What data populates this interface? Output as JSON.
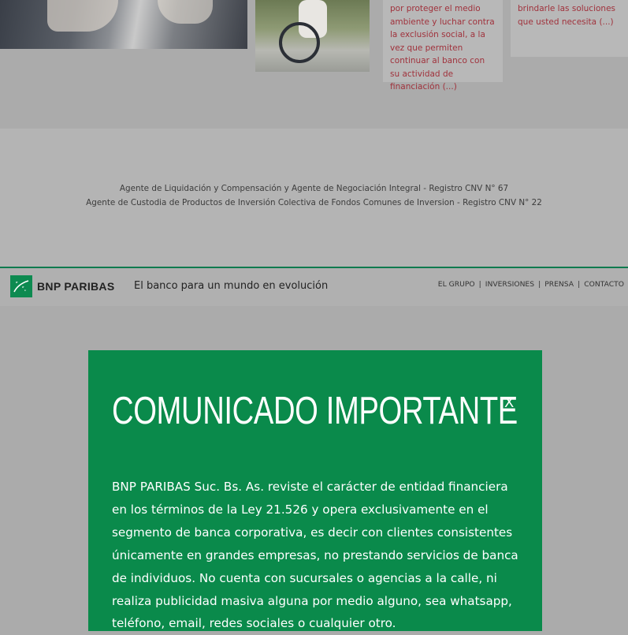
{
  "cards": {
    "card1_text": "por proteger el medio ambiente y luchar contra la exclusión social, a la vez que permiten continuar al banco con su actividad de financiación (...)",
    "card2_text": "brindarle las soluciones que usted necesita (...)"
  },
  "info": {
    "line1": "Agente de Liquidación y Compensación y Agente de Negociación Integral - Registro CNV N° 67",
    "line2": "Agente de Custodia de Productos de Inversión Colectiva de Fondos Comunes de Inversion - Registro CNV N° 22"
  },
  "header": {
    "logo_text": "BNP PARIBAS",
    "tagline": "El banco para un mundo en evolución",
    "nav": [
      "EL GRUPO",
      "INVERSIONES",
      "PRENSA",
      "CONTACTO"
    ],
    "separator": "|"
  },
  "modal": {
    "title": "COMUNICADO IMPORTANTE",
    "close_label": "X",
    "body": "BNP PARIBAS Suc. Bs. As. reviste el carácter de entidad financiera en los términos de la Ley 21.526 y opera exclusivamente en el segmento de banca corporativa, es decir con clientes consistentes únicamente en grandes empresas, no prestando servicios de banca de individuos. No cuenta con sucursales o agencias a la calle, ni realiza publicidad masiva alguna por medio alguno, sea whatsapp, teléfono, email, redes sociales o cualquier otro."
  },
  "colors": {
    "brand_green": "#0a8a4b",
    "overlay_gray": "#ababab",
    "card_text": "#a0323c"
  },
  "icons": {
    "logo": "bnp-stars-logo-icon"
  }
}
